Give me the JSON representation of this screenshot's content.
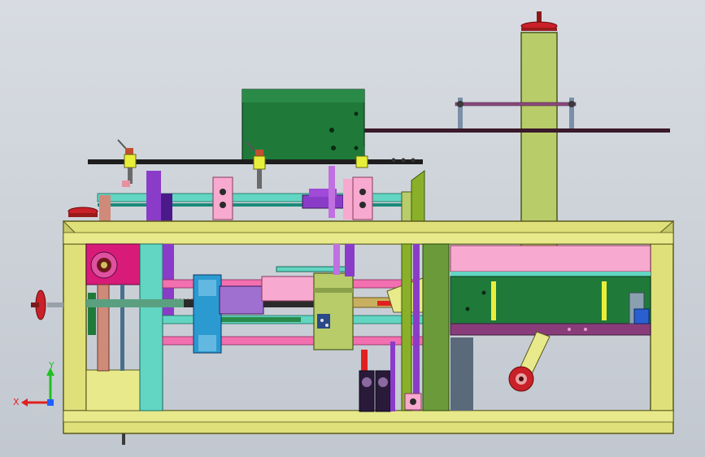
{
  "colors": {
    "frame": "#dfe07a",
    "frame_edge": "#5a5a1e",
    "olive_column": "#b8cc6a",
    "green_cabinet": "#1f7a3a",
    "pink": "#f26fb0",
    "light_pink": "#f7a9cf",
    "purple": "#8a3cc8",
    "cyan": "#62d6c2",
    "teal_bar": "#29c9b0",
    "magenta": "#d81b78",
    "yellow_block": "#e8ef3a",
    "dark_rail": "#2a2a2a",
    "red_handwheel": "#c9202a",
    "blue_motor": "#2a5fd0",
    "steel_blue": "#4a6f8a",
    "axis_x": "#e02020",
    "axis_y": "#20c020",
    "axis_z": "#2060ff"
  },
  "axis_triad": {
    "x_label": "X",
    "y_label": "Y"
  },
  "icons": [
    "handwheel-icon",
    "coordinate-triad-icon"
  ]
}
